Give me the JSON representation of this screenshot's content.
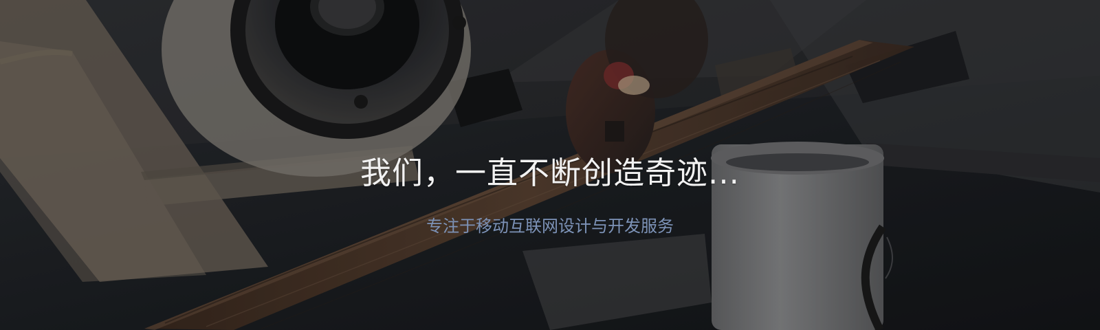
{
  "hero": {
    "title": "我们，一直不断创造奇迹...",
    "subtitle": "专注于移动互联网设计与开发服务"
  }
}
